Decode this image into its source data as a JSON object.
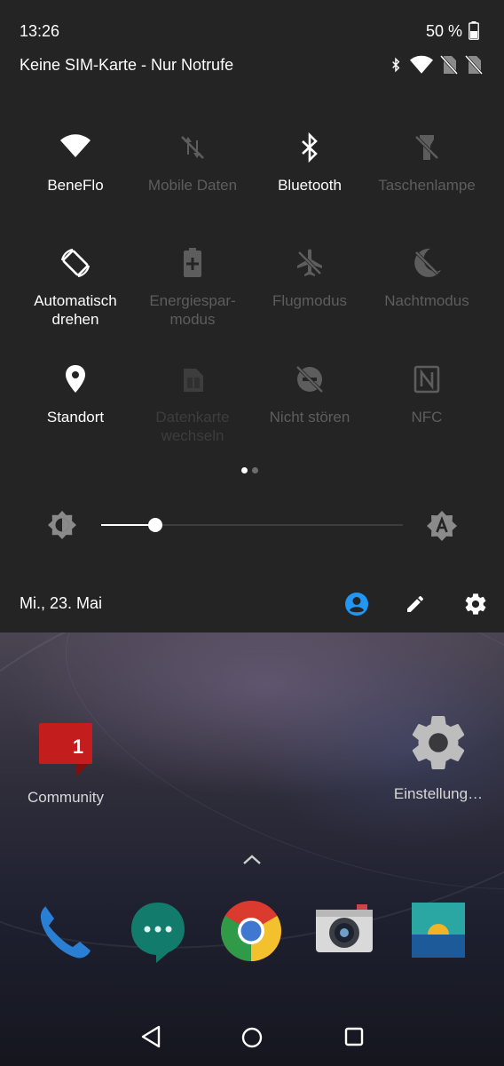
{
  "status": {
    "time": "13:26",
    "battery": "50 %",
    "carrier": "Keine SIM-Karte - Nur Notrufe",
    "icons": [
      "bluetooth-icon",
      "wifi-icon",
      "no-sim-icon",
      "no-sim-icon"
    ]
  },
  "tiles": [
    {
      "label": "BeneFlo",
      "icon": "wifi-icon",
      "active": true
    },
    {
      "label": "Mobile Daten",
      "icon": "mobile-data-off-icon",
      "active": false
    },
    {
      "label": "Bluetooth",
      "icon": "bluetooth-icon",
      "active": true
    },
    {
      "label": "Taschenlampe",
      "icon": "flashlight-off-icon",
      "active": false
    },
    {
      "label": "Automatisch drehen",
      "icon": "auto-rotate-icon",
      "active": true
    },
    {
      "label": "Energiespar-modus",
      "icon": "battery-saver-icon",
      "active": false
    },
    {
      "label": "Flugmodus",
      "icon": "airplane-off-icon",
      "active": false
    },
    {
      "label": "Nachtmodus",
      "icon": "night-mode-off-icon",
      "active": false
    },
    {
      "label": "Standort",
      "icon": "location-icon",
      "active": true
    },
    {
      "label": "Datenkarte wechseln",
      "icon": "sim-card-icon",
      "active": false
    },
    {
      "label": "Nicht stören",
      "icon": "do-not-disturb-off-icon",
      "active": false
    },
    {
      "label": "NFC",
      "icon": "nfc-icon",
      "active": false
    }
  ],
  "brightness": {
    "level": 0.18
  },
  "footer": {
    "date": "Mi., 23. Mai"
  },
  "home": {
    "apps": [
      {
        "label": "Community",
        "badge": "1"
      },
      {
        "label": "Einstellung…"
      }
    ],
    "dock": [
      "phone-icon",
      "messages-icon",
      "chrome-icon",
      "camera-icon",
      "gallery-icon"
    ]
  },
  "colors": {
    "accent": "#2196f3",
    "panel": "#242424",
    "inactive": "#5d5d5d"
  }
}
